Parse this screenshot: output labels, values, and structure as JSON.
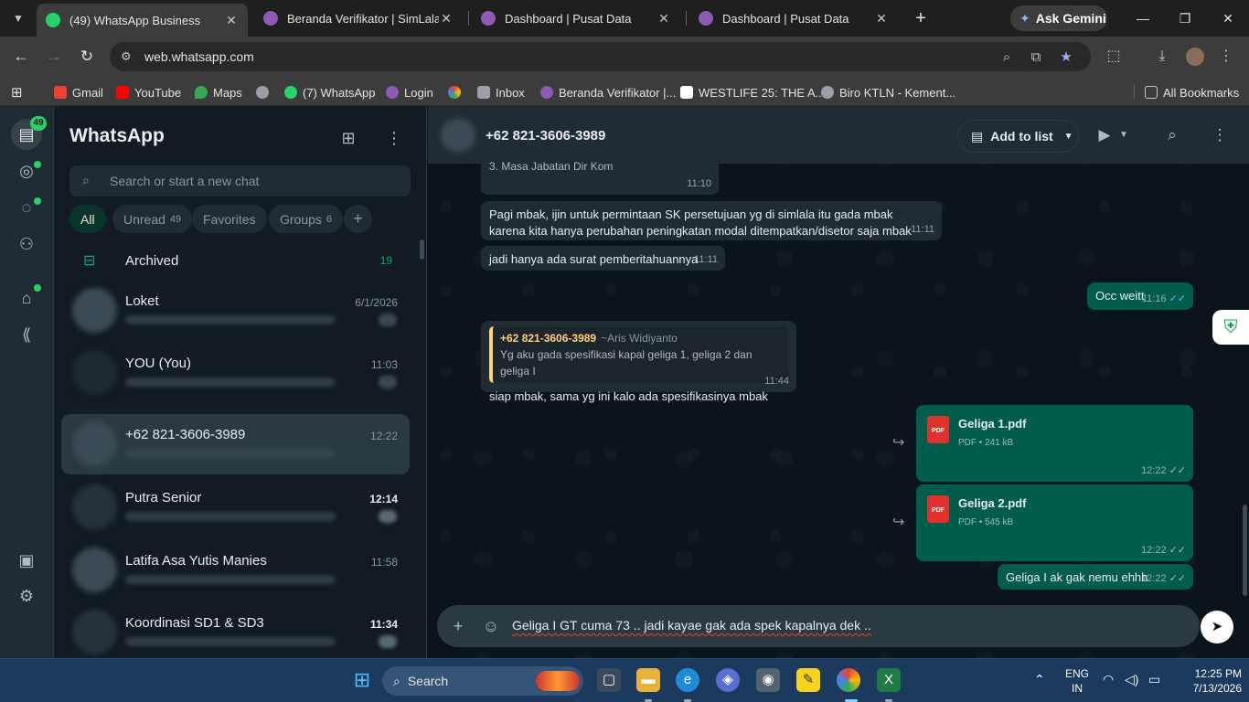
{
  "browser": {
    "tabs": [
      {
        "title": "(49) WhatsApp Business",
        "active": true
      },
      {
        "title": "Beranda Verifikator | SimLala",
        "active": false
      },
      {
        "title": "Dashboard | Pusat Data",
        "active": false
      },
      {
        "title": "Dashboard | Pusat Data",
        "active": false
      }
    ],
    "ask_gemini": "Ask Gemini",
    "url": "web.whatsapp.com",
    "bookmarks": [
      "Gmail",
      "YouTube",
      "Maps",
      "(7) WhatsApp",
      "Login",
      "Inbox",
      "Beranda Verifikator |...",
      "WESTLIFE 25: THE A...",
      "Biro KTLN - Kement..."
    ],
    "all_bookmarks": "All Bookmarks"
  },
  "rail": {
    "chats_badge": "49"
  },
  "sidebar": {
    "title": "WhatsApp",
    "search_placeholder": "Search or start a new chat",
    "filters": [
      {
        "label": "All",
        "count": ""
      },
      {
        "label": "Unread",
        "count": "49"
      },
      {
        "label": "Favorites",
        "count": ""
      },
      {
        "label": "Groups",
        "count": "6"
      }
    ],
    "archived_label": "Archived",
    "archived_count": "19",
    "chats": [
      {
        "name": "Loket",
        "time": "6/1/2026"
      },
      {
        "name": "YOU (You)",
        "time": "11:03"
      },
      {
        "name": "+62 821-3606-3989",
        "time": "12:22"
      },
      {
        "name": "Putra Senior",
        "time": "12:14"
      },
      {
        "name": "Latifa Asa Yutis Manies",
        "time": "11:58"
      },
      {
        "name": "Koordinasi SD1 & SD3",
        "time": "11:34"
      }
    ]
  },
  "conversation": {
    "contact": "+62 821-3606-3989",
    "add_to_list": "Add to list",
    "messages": [
      {
        "text": "3. Masa Jabatan Dir Kom",
        "time": "11:10"
      },
      {
        "text": "Pagi mbak, ijin untuk permintaan SK persetujuan yg di simlala itu gada mbak karena kita hanya perubahan peningkatan modal ditempatkan/disetor saja mbak",
        "time": "11:11"
      },
      {
        "text": "jadi hanya ada surat pemberitahuannya",
        "time": "11:11"
      },
      {
        "text": "Occ weitt",
        "time": "11:16"
      },
      {
        "quote_name": "+62 821-3606-3989",
        "quote_alias": "~Aris Widiyanto",
        "quote_text": "Yg aku gada spesifikasi kapal geliga 1, geliga 2 dan geliga I",
        "text": "siap mbak, sama yg ini kalo ada spesifikasinya mbak",
        "time": "11:44"
      },
      {
        "file": "Geliga 1.pdf",
        "info": "PDF • 241 kB",
        "time": "12:22",
        "icon_label": "PDF"
      },
      {
        "file": "Geliga 2.pdf",
        "info": "PDF • 545 kB",
        "time": "12:22",
        "icon_label": "PDF"
      },
      {
        "text": "Geliga I ak gak nemu ehhh",
        "time": "12:22"
      }
    ],
    "compose_text": "Geliga I GT cuma 73 .. jadi kayae gak ada spek kapalnya dek .."
  },
  "taskbar": {
    "search": "Search",
    "lang": "ENG",
    "region": "IN",
    "time": "12:25 PM",
    "date": "7/13/2026"
  },
  "colors": {
    "accent": "#00a884",
    "outgoing": "#005c4b",
    "incoming": "#202c33",
    "quote_bar": "#ffd279"
  }
}
